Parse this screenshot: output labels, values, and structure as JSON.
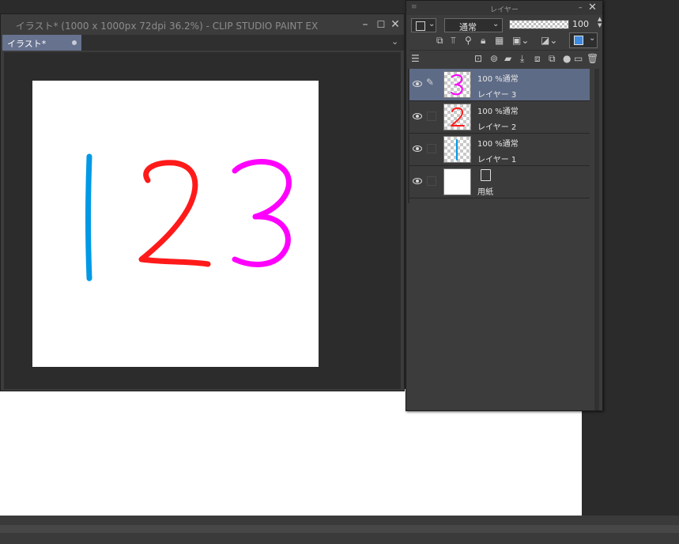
{
  "canvas_window": {
    "title": "イラスト* (1000 x 1000px 72dpi 36.2%)  - CLIP STUDIO PAINT EX",
    "tab_label": "イラスト*",
    "minimize": "–",
    "maximize": "☐",
    "close": "✕",
    "tab_menu": "⌄"
  },
  "artwork": {
    "digit_1": "1",
    "digit_2": "2",
    "digit_3": "3",
    "color_1": "#0099e6",
    "color_2": "#ff1a1a",
    "color_3": "#ff00ff"
  },
  "layer_panel": {
    "title": "レイヤー",
    "close": "✕",
    "blend_mode": "通常",
    "opacity_value": "100",
    "opacity_percent": 1.0,
    "toolbar_icons": [
      "layer-property-icon",
      "clip-icon",
      "reference-icon",
      "lock-icon",
      "lock-transparent-icon",
      "mask-icon",
      "mask-enable-icon",
      "color-icon"
    ],
    "action_icons": [
      "new-raster-layer-icon",
      "new-vector-layer-icon",
      "new-folder-icon",
      "transfer-icon",
      "combine-icon",
      "mask-create-icon",
      "apply-mask-icon",
      "delete-icon"
    ],
    "layers": [
      {
        "mode": "100 %通常",
        "name": "レイヤー 3",
        "selected": true,
        "thumb_digit": "3",
        "thumb_color": "#ff00ff"
      },
      {
        "mode": "100 %通常",
        "name": "レイヤー 2",
        "selected": false,
        "thumb_digit": "2",
        "thumb_color": "#ff1a1a"
      },
      {
        "mode": "100 %通常",
        "name": "レイヤー 1",
        "selected": false,
        "thumb_digit": "1",
        "thumb_color": "#0099e6"
      },
      {
        "mode": "",
        "name": "用紙",
        "selected": false,
        "thumb_digit": "",
        "thumb_color": "#ffffff"
      }
    ]
  }
}
